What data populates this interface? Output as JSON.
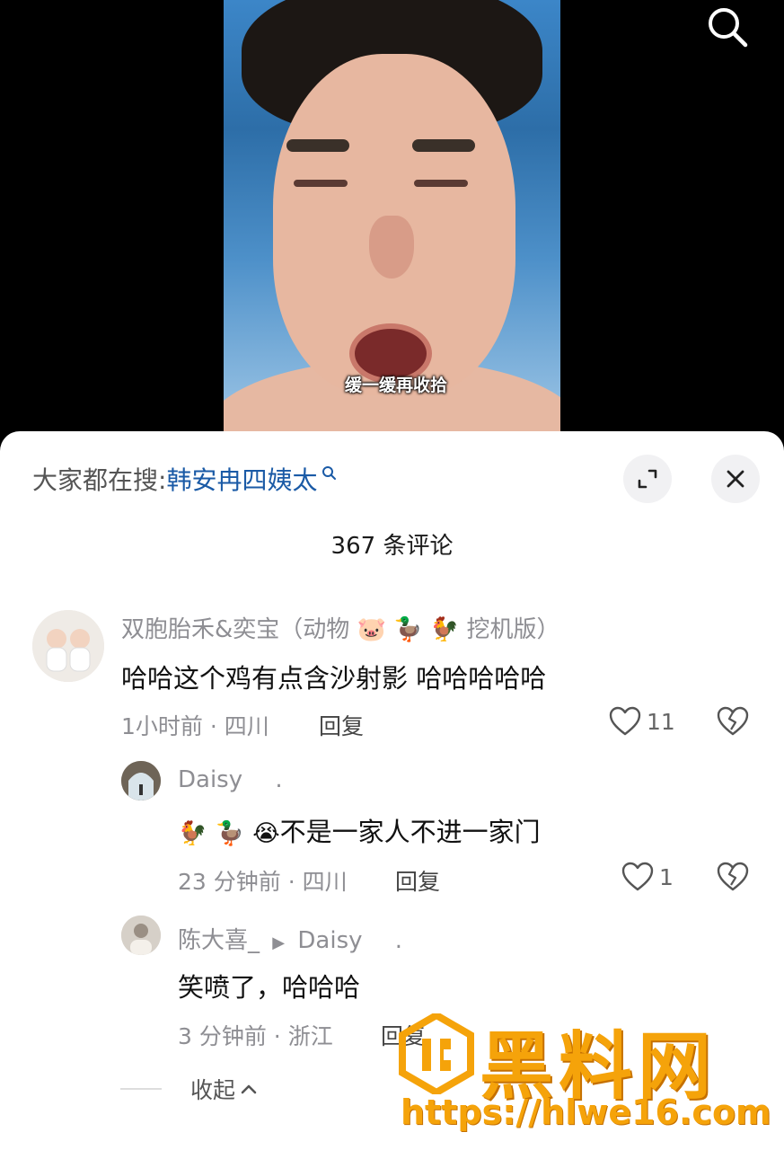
{
  "video": {
    "caption": "缓一缓再收拾"
  },
  "header": {
    "hot_search_prefix": "大家都在搜:",
    "hot_search_term": "韩安冉四姨太",
    "comment_count": "367 条评论"
  },
  "comments": [
    {
      "author": "双胞胎禾&奕宝（动物",
      "author_emojis": [
        "🐷",
        "🦆",
        "🐓"
      ],
      "author_suffix": "挖机版）",
      "text": "哈哈这个鸡有点含沙射影 哈哈哈哈哈",
      "meta": "1小时前 · 四川",
      "reply_label": "回复",
      "likes": "11"
    },
    {
      "author": "Daisy",
      "author_suffix": ".",
      "emojis": [
        "🐓",
        "🦆",
        "😭"
      ],
      "text": "不是一家人不进一家门",
      "meta": "23 分钟前 · 四川",
      "reply_label": "回复",
      "likes": "1"
    },
    {
      "author": "陈大喜_",
      "reply_to": "Daisy",
      "author_suffix": ".",
      "text": "笑喷了，哈哈哈",
      "meta": "3 分钟前 · 浙江",
      "reply_label": "回复"
    }
  ],
  "collapse_label": "收起",
  "watermark": {
    "title": "黑料网",
    "url": "https://hlwe16.com"
  },
  "colors": {
    "link": "#1a5aa6",
    "watermark": "#f5a30a",
    "secondary_text": "#8e8e93"
  }
}
